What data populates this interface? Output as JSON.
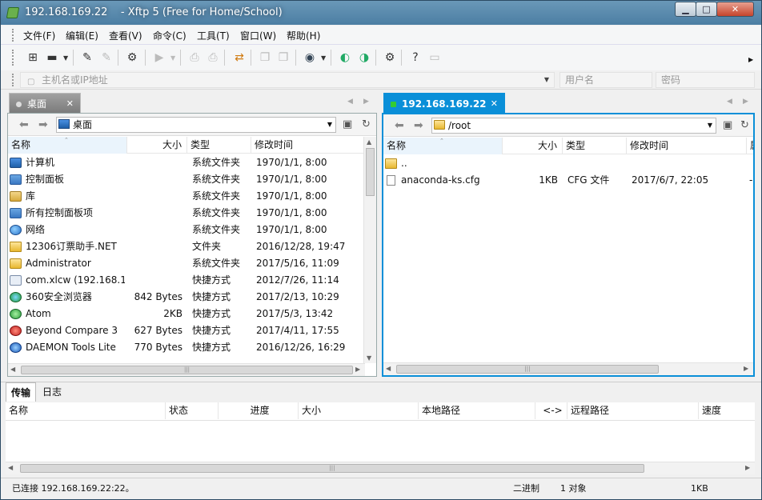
{
  "window": {
    "title": "192.168.169.22    - Xftp 5 (Free for Home/School)",
    "min_icon": "minimize-icon",
    "max_icon": "maximize-icon",
    "close_icon": "close-icon"
  },
  "menu": [
    "文件(F)",
    "编辑(E)",
    "查看(V)",
    "命令(C)",
    "工具(T)",
    "窗口(W)",
    "帮助(H)"
  ],
  "address": {
    "host_placeholder": "主机名或IP地址",
    "user_placeholder": "用户名",
    "pass_placeholder": "密码"
  },
  "left_tab": {
    "label": "桌面"
  },
  "right_tab": {
    "label": "192.168.169.22"
  },
  "left_pane": {
    "path": "桌面",
    "columns": [
      "名称",
      "大小",
      "类型",
      "修改时间"
    ],
    "rows": [
      {
        "name": "计算机",
        "size": "",
        "type": "系统文件夹",
        "date": "1970/1/1, 8:00",
        "icon": "computer-icon"
      },
      {
        "name": "控制面板",
        "size": "",
        "type": "系统文件夹",
        "date": "1970/1/1, 8:00",
        "icon": "control-panel-icon"
      },
      {
        "name": "库",
        "size": "",
        "type": "系统文件夹",
        "date": "1970/1/1, 8:00",
        "icon": "library-icon"
      },
      {
        "name": "所有控制面板项",
        "size": "",
        "type": "系统文件夹",
        "date": "1970/1/1, 8:00",
        "icon": "control-panel-icon"
      },
      {
        "name": "网络",
        "size": "",
        "type": "系统文件夹",
        "date": "1970/1/1, 8:00",
        "icon": "network-icon"
      },
      {
        "name": "12306订票助手.NET",
        "size": "",
        "type": "文件夹",
        "date": "2016/12/28, 19:47",
        "icon": "folder-icon"
      },
      {
        "name": "Administrator",
        "size": "",
        "type": "系统文件夹",
        "date": "2017/5/16, 11:09",
        "icon": "user-folder-icon"
      },
      {
        "name": "com.xlcw (192.168.1...",
        "size": "",
        "type": "快捷方式",
        "date": "2012/7/26, 11:14",
        "icon": "shortcut-icon"
      },
      {
        "name": "360安全浏览器",
        "size": "842 Bytes",
        "type": "快捷方式",
        "date": "2017/2/13, 10:29",
        "icon": "browser-360-icon"
      },
      {
        "name": "Atom",
        "size": "2KB",
        "type": "快捷方式",
        "date": "2017/5/3, 13:42",
        "icon": "atom-icon"
      },
      {
        "name": "Beyond Compare 3",
        "size": "627 Bytes",
        "type": "快捷方式",
        "date": "2017/4/11, 17:55",
        "icon": "beyond-compare-icon"
      },
      {
        "name": "DAEMON Tools Lite",
        "size": "770 Bytes",
        "type": "快捷方式",
        "date": "2016/12/26, 16:29",
        "icon": "daemon-tools-icon"
      }
    ]
  },
  "right_pane": {
    "path": "/root",
    "columns": [
      "名称",
      "大小",
      "类型",
      "修改时间",
      "属"
    ],
    "rows": [
      {
        "name": "..",
        "size": "",
        "type": "",
        "date": "",
        "icon": "folder-icon"
      },
      {
        "name": "anaconda-ks.cfg",
        "size": "1KB",
        "type": "CFG 文件",
        "date": "2017/6/7, 22:05",
        "icon": "file-icon"
      }
    ],
    "extra_cell": "-"
  },
  "transfer": {
    "tabs": [
      "传输",
      "日志"
    ],
    "columns": [
      "名称",
      "状态",
      "进度",
      "大小",
      "本地路径",
      "<->",
      "远程路径",
      "速度"
    ]
  },
  "status": {
    "connection": "已连接 192.168.169.22:22。",
    "mode": "二进制",
    "objects": "1 对象",
    "size": "1KB"
  },
  "colors": {
    "accent": "#0a8fd8",
    "titlebar": "#5a8cb0",
    "close": "#c6442c"
  }
}
